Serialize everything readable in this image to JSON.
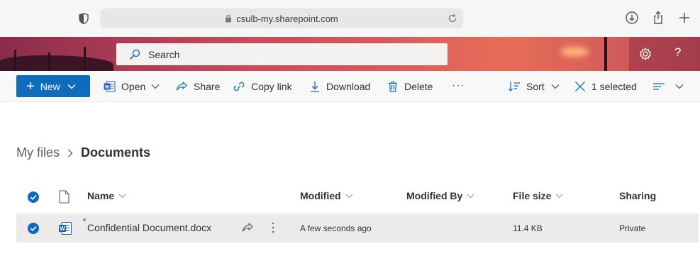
{
  "browser": {
    "url": "csulb-my.sharepoint.com"
  },
  "search": {
    "placeholder": "Search"
  },
  "banner": {
    "help_label": "?"
  },
  "commands": {
    "new_label": "New",
    "open_label": "Open",
    "share_label": "Share",
    "copy_link_label": "Copy link",
    "download_label": "Download",
    "delete_label": "Delete",
    "more_label": "···",
    "sort_label": "Sort",
    "selected_label": "1 selected"
  },
  "breadcrumb": {
    "root": "My files",
    "current": "Documents"
  },
  "table": {
    "columns": {
      "name": "Name",
      "modified": "Modified",
      "modified_by": "Modified By",
      "file_size": "File size",
      "sharing": "Sharing"
    },
    "rows": [
      {
        "name": "Confidential Document.docx",
        "modified": "A few seconds ago",
        "modified_by": "",
        "file_size": "11.4 KB",
        "sharing": "Private",
        "selected": true
      }
    ]
  },
  "colors": {
    "accent": "#0f6cbd",
    "word_blue": "#185abd",
    "row_selected": "#edebe9"
  }
}
